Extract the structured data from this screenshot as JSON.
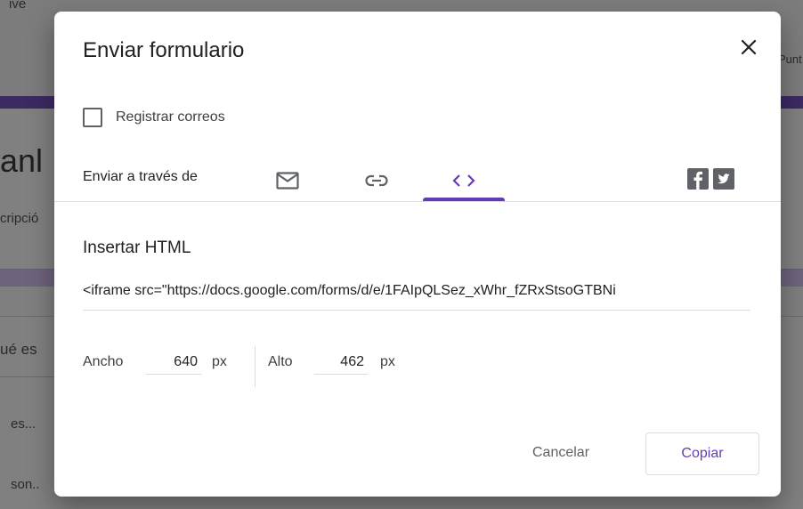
{
  "background": {
    "top_left_text": "ive",
    "right_text": "Punt",
    "heading_fragment": "anl",
    "desc_fragment": "cripció",
    "question_fragment": "ué es",
    "item1_fragment": "es...",
    "item2_fragment": "son.."
  },
  "dialog": {
    "title": "Enviar formulario",
    "close_icon": "close-icon",
    "collect_emails_label": "Registrar correos",
    "collect_emails_checked": false,
    "send_via_label": "Enviar a través de",
    "tabs": [
      {
        "name": "email",
        "icon": "mail-icon",
        "active": false
      },
      {
        "name": "link",
        "icon": "link-icon",
        "active": false
      },
      {
        "name": "embed",
        "icon": "code-icon",
        "active": true
      }
    ],
    "social": [
      "facebook-icon",
      "twitter-icon"
    ],
    "embed_title": "Insertar HTML",
    "embed_code": "<iframe src=\"https://docs.google.com/forms/d/e/1FAIpQLSez_xWhr_fZRxStsoGTBNi",
    "width_label": "Ancho",
    "width_value": "640",
    "height_label": "Alto",
    "height_value": "462",
    "unit": "px",
    "cancel_label": "Cancelar",
    "copy_label": "Copiar"
  },
  "colors": {
    "accent": "#673ab7",
    "icon": "#5f6368",
    "text": "#202124"
  }
}
